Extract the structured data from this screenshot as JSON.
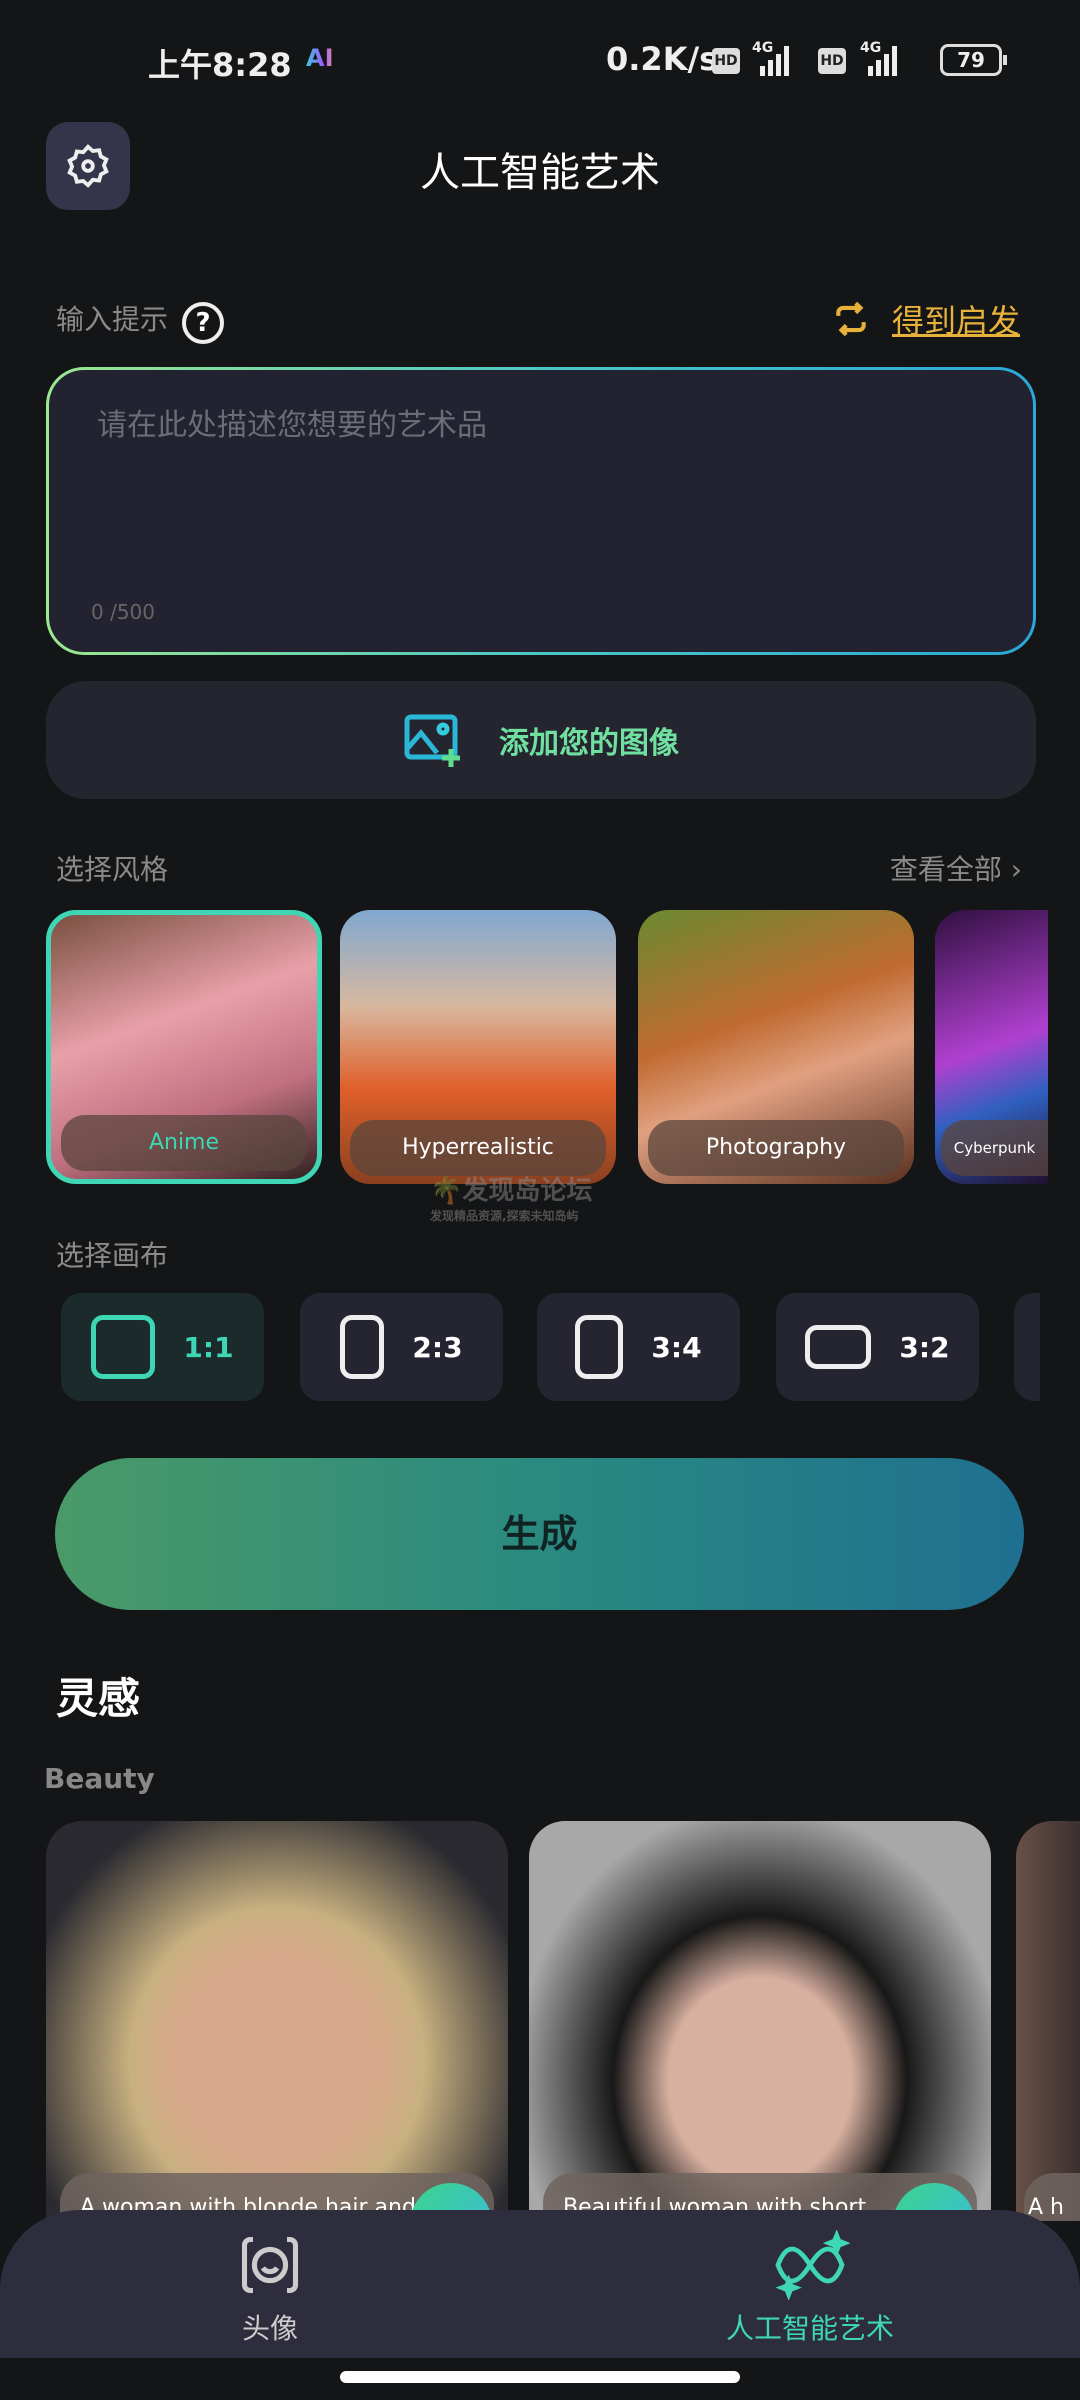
{
  "status_bar": {
    "time": "上午8:28",
    "app_icon": "AI",
    "net_speed": "0.2K/s",
    "hd": "HD",
    "network": "4G",
    "battery": "79"
  },
  "header": {
    "title": "人工智能艺术",
    "settings_icon": "gear-icon"
  },
  "prompt": {
    "label": "输入提示",
    "help": "?",
    "inspire": "得到启发",
    "placeholder": "请在此处描述您想要的艺术品",
    "value": "",
    "count": "0 /500"
  },
  "add_image": {
    "label": "添加您的图像"
  },
  "styles": {
    "label": "选择风格",
    "see_all": "查看全部",
    "items": [
      {
        "label": "Anime",
        "selected": true
      },
      {
        "label": "Hyperrealistic"
      },
      {
        "label": "Photography"
      },
      {
        "label": "Cyberpunk"
      }
    ]
  },
  "canvas": {
    "label": "选择画布",
    "items": [
      {
        "label": "1:1",
        "selected": true
      },
      {
        "label": "2:3"
      },
      {
        "label": "3:4"
      },
      {
        "label": "3:2"
      }
    ]
  },
  "generate": {
    "label": "生成"
  },
  "inspiration": {
    "title": "灵感",
    "category": "Beauty",
    "items": [
      {
        "caption": "A woman with blonde hair and"
      },
      {
        "caption": "Beautiful woman with short"
      },
      {
        "caption": "A h"
      }
    ]
  },
  "watermark": {
    "title": "发现岛论坛",
    "subtitle": "发现精品资源,探索未知岛屿"
  },
  "nav": {
    "items": [
      {
        "label": "头像",
        "active": false
      },
      {
        "label": "人工智能艺术",
        "active": true
      }
    ]
  },
  "colors": {
    "accent": "#3ed6b4",
    "inspire": "#e8b23a",
    "background": "#141516"
  }
}
